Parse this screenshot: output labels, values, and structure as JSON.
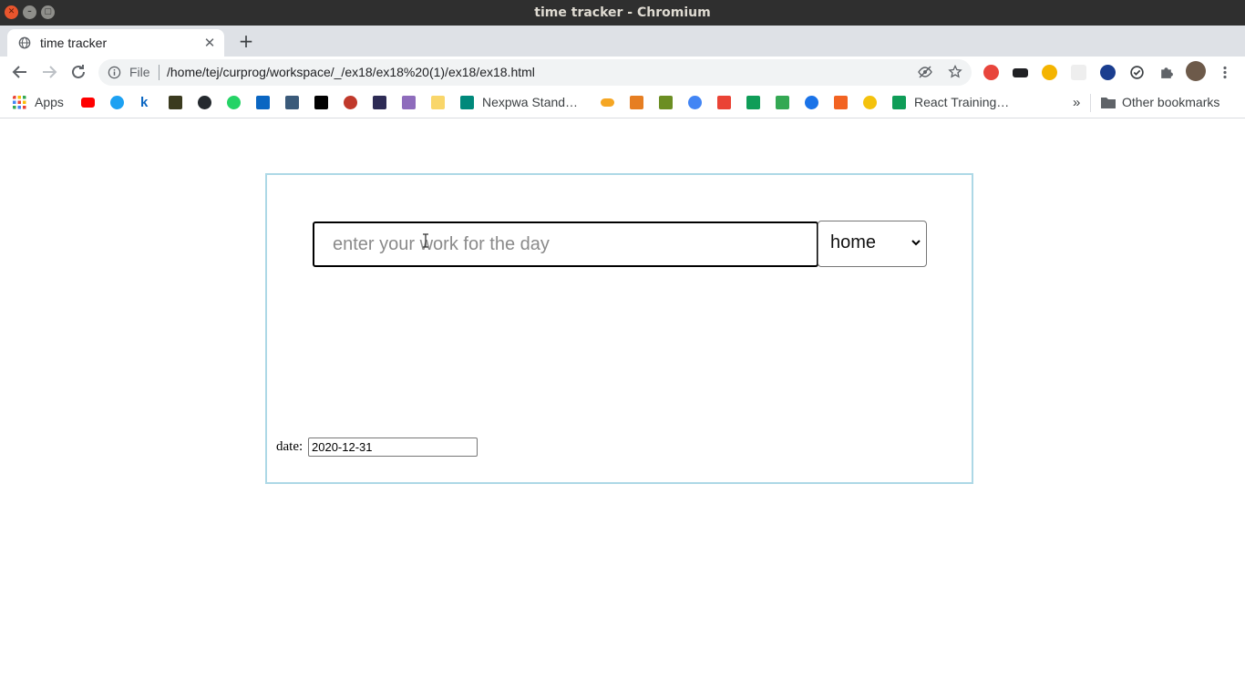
{
  "window": {
    "title": "time tracker - Chromium",
    "controls": {
      "close": "✕",
      "minimize": "–",
      "maximize": "▢"
    }
  },
  "tabs": [
    {
      "title": "time tracker",
      "active": true
    }
  ],
  "toolbar": {
    "scheme_label": "File",
    "url": "/home/tej/curprog/workspace/_/ex18/ex18%20(1)/ex18/ex18.html"
  },
  "bookmarks": {
    "apps_label": "Apps",
    "items": [
      {
        "label": "Nexpwa Stand…"
      },
      {
        "label": "React Training…"
      }
    ],
    "overflow": "»",
    "other_label": "Other bookmarks"
  },
  "page": {
    "work_input": {
      "placeholder": "enter your work for the day",
      "value": ""
    },
    "category_select": {
      "selected": "home"
    },
    "date_label": "date:",
    "date_value": "2020-12-31"
  },
  "colors": {
    "box_border": "#add8e6",
    "titlebar": "#2f2f2f",
    "tabstrip": "#dee1e6"
  }
}
